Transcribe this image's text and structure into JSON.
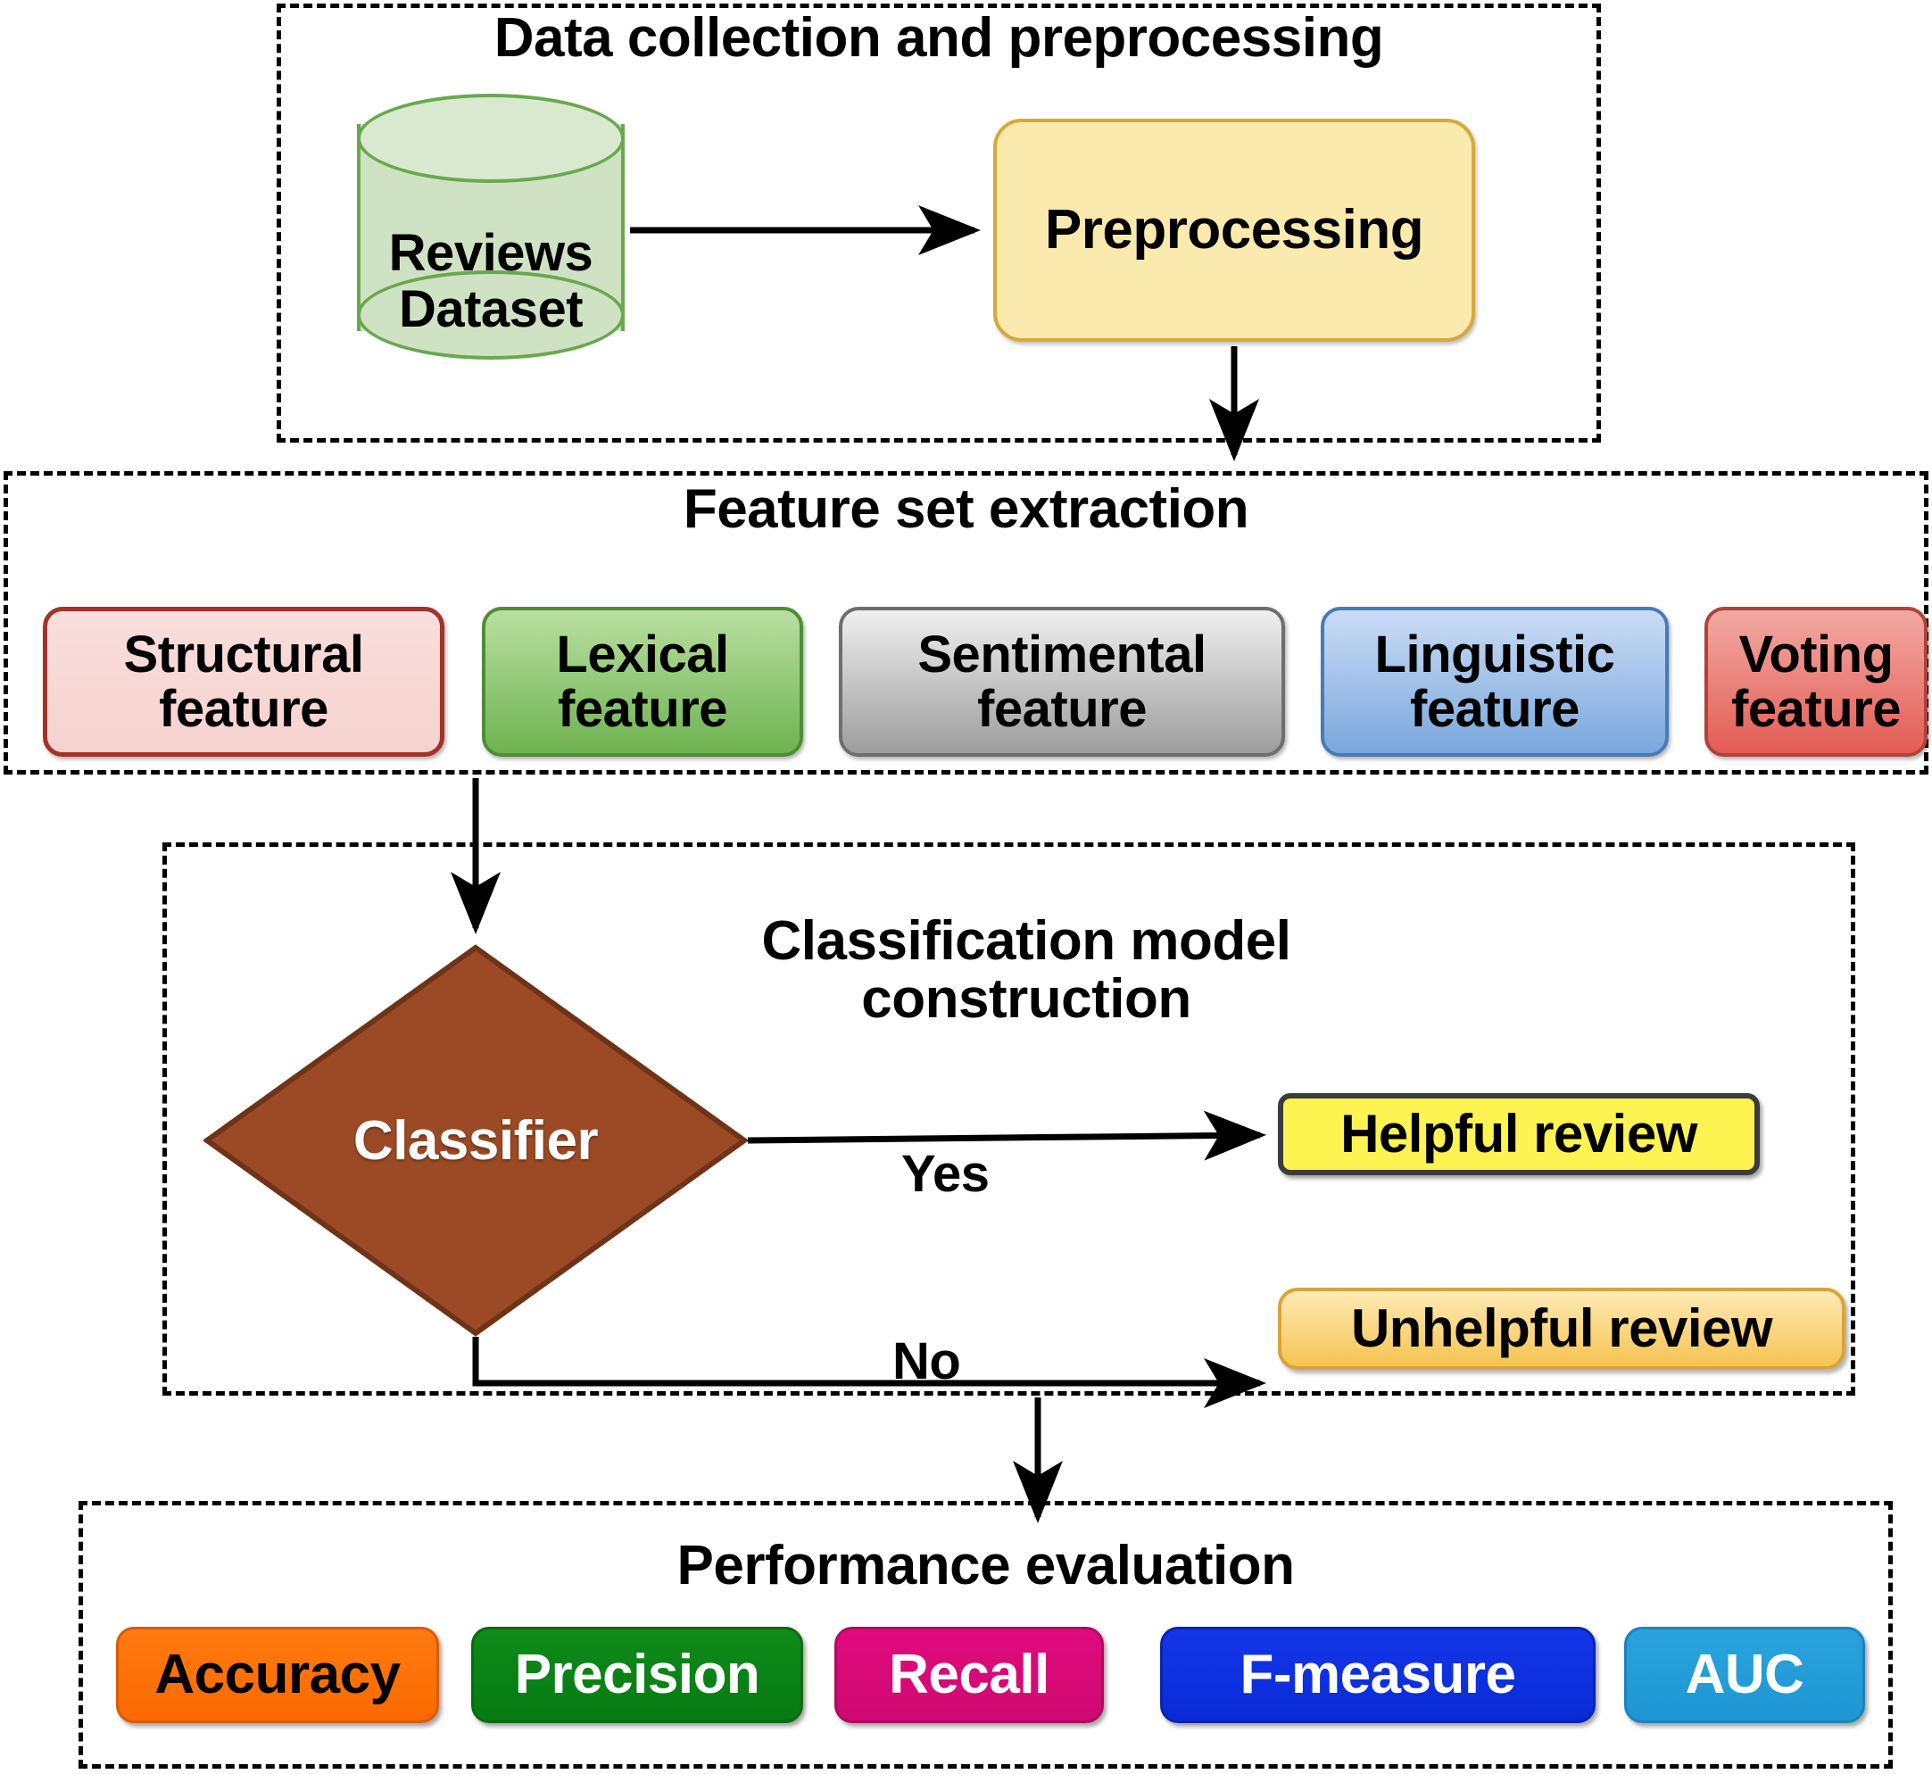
{
  "sections": [
    {
      "id": "data-collection",
      "title": "Data collection and preprocessing"
    },
    {
      "id": "feature-extraction",
      "title": "Feature set extraction"
    },
    {
      "id": "classification",
      "title": "Classification model\nconstruction"
    },
    {
      "id": "performance",
      "title": "Performance evaluation"
    }
  ],
  "nodes": {
    "dataset": {
      "label": "Reviews\nDataset",
      "shape": "cylinder",
      "fill": "#cfe3c4",
      "stroke": "#6aa84f"
    },
    "preprocessing": {
      "label": "Preprocessing",
      "shape": "rounded-rect",
      "fill": "#fbeaae",
      "stroke": "#d4aa3c"
    },
    "classifier": {
      "label": "Classifier",
      "shape": "diamond",
      "fill": "#9c4a26",
      "stroke": "#6e3318",
      "text_color": "#ffffff"
    },
    "helpful": {
      "label": "Helpful review",
      "shape": "rounded-rect",
      "fill": "#fdf451",
      "stroke": "#3c3c3c"
    },
    "unhelpful": {
      "label": "Unhelpful review",
      "shape": "rounded-rect",
      "fill": "#f9d47a",
      "stroke": "#d7a43a"
    }
  },
  "features": [
    {
      "label": "Structural\nfeature",
      "fill": "#f6d2cf",
      "stroke": "#a33227"
    },
    {
      "label": "Lexical\nfeature",
      "fill": "#6fb351",
      "stroke": "#4f8c38"
    },
    {
      "label": "Sentimental\nfeature",
      "fill": "#9d9d9d",
      "stroke": "#6e6e6e"
    },
    {
      "label": "Linguistic\nfeature",
      "fill": "#7aa7dd",
      "stroke": "#4a7ab5"
    },
    {
      "label": "Voting\nfeature",
      "fill": "#e35d55",
      "stroke": "#b0423a"
    }
  ],
  "metrics": [
    {
      "label": "Accuracy",
      "fill": "#f96a00",
      "text_color": "#000000"
    },
    {
      "label": "Precision",
      "fill": "#067b12",
      "text_color": "#ffffff"
    },
    {
      "label": "Recall",
      "fill": "#cf0a72",
      "text_color": "#ffffff"
    },
    {
      "label": "F-measure",
      "fill": "#0a2ad6",
      "text_color": "#ffffff"
    },
    {
      "label": "AUC",
      "fill": "#1e96d3",
      "text_color": "#ffffff"
    }
  ],
  "edges": {
    "dataset_to_preprocessing": "",
    "preprocessing_to_features": "",
    "features_to_classifier": "",
    "classifier_yes": "Yes",
    "classifier_no": "No",
    "to_performance": ""
  }
}
